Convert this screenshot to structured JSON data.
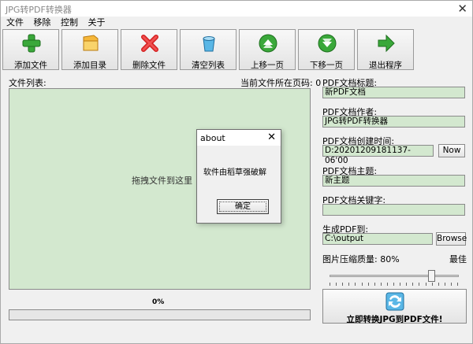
{
  "window": {
    "title": "JPG转PDF转换器"
  },
  "menu": [
    "文件",
    "移除",
    "控制",
    "关于"
  ],
  "toolbar": [
    {
      "label": "添加文件",
      "icon": "add-file-icon"
    },
    {
      "label": "添加目录",
      "icon": "folder-icon"
    },
    {
      "label": "删除文件",
      "icon": "delete-icon"
    },
    {
      "label": "清空列表",
      "icon": "clear-list-icon"
    },
    {
      "label": "上移一页",
      "icon": "arrow-up-icon"
    },
    {
      "label": "下移一页",
      "icon": "arrow-down-icon"
    },
    {
      "label": "退出程序",
      "icon": "exit-icon"
    }
  ],
  "filelist": {
    "label": "文件列表:",
    "page_label": "当前文件所在页码: 0",
    "drag_hint": "拖拽文件到这里"
  },
  "progress": {
    "text": "0%",
    "value": 0
  },
  "pdf": {
    "title_label": "PDF文档标题:",
    "title_value": "新PDF文档",
    "author_label": "PDF文档作者:",
    "author_value": "JPG转PDF转换器",
    "created_label": "PDF文档创建时间:",
    "created_value": "D:20201209181137-06'00",
    "now_button": "Now",
    "subject_label": "PDF文档主题:",
    "subject_value": "新主题",
    "keywords_label": "PDF文档关键字:",
    "keywords_value": "",
    "output_label": "生成PDF到:",
    "output_value": "C:\\output",
    "browse_button": "Browse",
    "quality_label": "图片压缩质量: 80%",
    "quality_max": "最佳",
    "quality_value": 80,
    "convert_button": "立即转换JPG到PDF文件!"
  },
  "dialog": {
    "title": "about",
    "message": "软件由稻草强破解",
    "ok_button": "确定"
  },
  "colors": {
    "field_bg": "#d3e8cf",
    "accent_green": "#3aa83a"
  }
}
